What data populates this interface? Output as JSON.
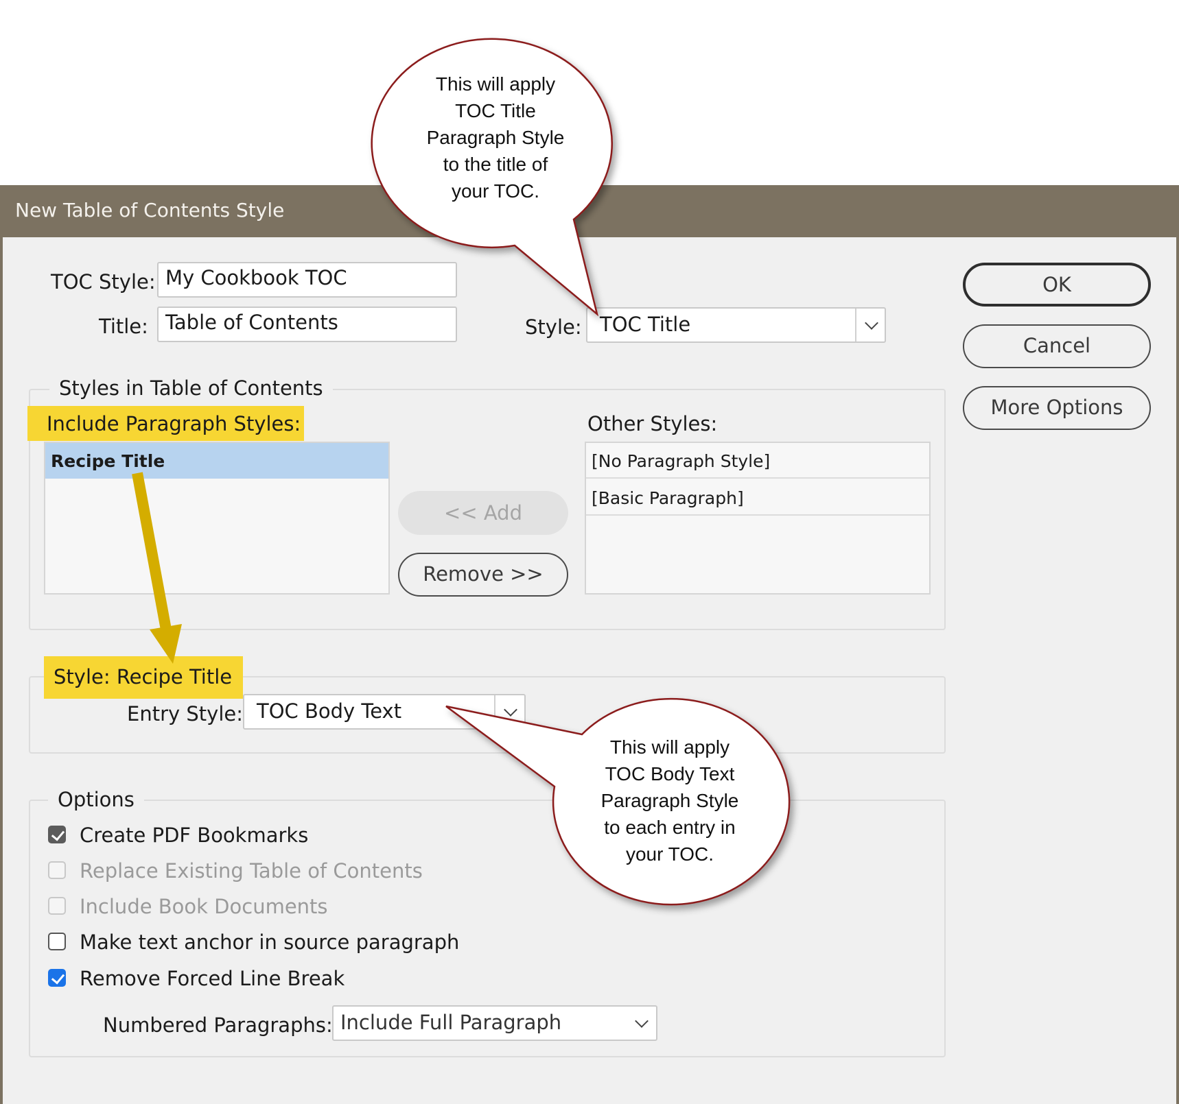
{
  "dialog": {
    "title": "New Table of Contents Style",
    "toc_style_label": "TOC Style:",
    "toc_style_value": "My Cookbook TOC",
    "title_label": "Title:",
    "title_value": "Table of Contents",
    "style_label": "Style:",
    "style_value": "TOC Title"
  },
  "buttons": {
    "ok": "OK",
    "cancel": "Cancel",
    "more_options": "More Options",
    "add": "<< Add",
    "remove": "Remove >>"
  },
  "styles_group": {
    "legend": "Styles in Table of Contents",
    "include_label": "Include Paragraph Styles:",
    "include_items": [
      "Recipe Title"
    ],
    "other_label": "Other Styles:",
    "other_items": [
      "[No Paragraph Style]",
      "[Basic Paragraph]"
    ]
  },
  "style_group": {
    "legend": "Style: Recipe Title",
    "entry_style_label": "Entry Style:",
    "entry_style_value": "TOC Body Text"
  },
  "options": {
    "legend": "Options",
    "checkboxes": [
      {
        "label": "Create PDF Bookmarks",
        "checked": true,
        "enabled": true
      },
      {
        "label": "Replace Existing Table of Contents",
        "checked": false,
        "enabled": false
      },
      {
        "label": "Include Book Documents",
        "checked": false,
        "enabled": false
      },
      {
        "label": "Make text anchor in source paragraph",
        "checked": false,
        "enabled": true
      },
      {
        "label": "Remove Forced Line Break",
        "checked": true,
        "enabled": true
      }
    ],
    "numbered_label": "Numbered Paragraphs:",
    "numbered_value": "Include Full Paragraph"
  },
  "callouts": {
    "top": [
      "This will apply",
      "TOC Title",
      "Paragraph Style",
      "to the title of",
      "your TOC."
    ],
    "bottom": [
      "This will apply",
      "TOC Body Text",
      "Paragraph Style",
      "to each entry in",
      "your TOC."
    ]
  },
  "colors": {
    "titlebar": "#7c7261",
    "highlight": "#f7d633",
    "selection": "#b7d3ef",
    "callout_border": "#8b1a1a",
    "arrow": "#d4ad00"
  }
}
